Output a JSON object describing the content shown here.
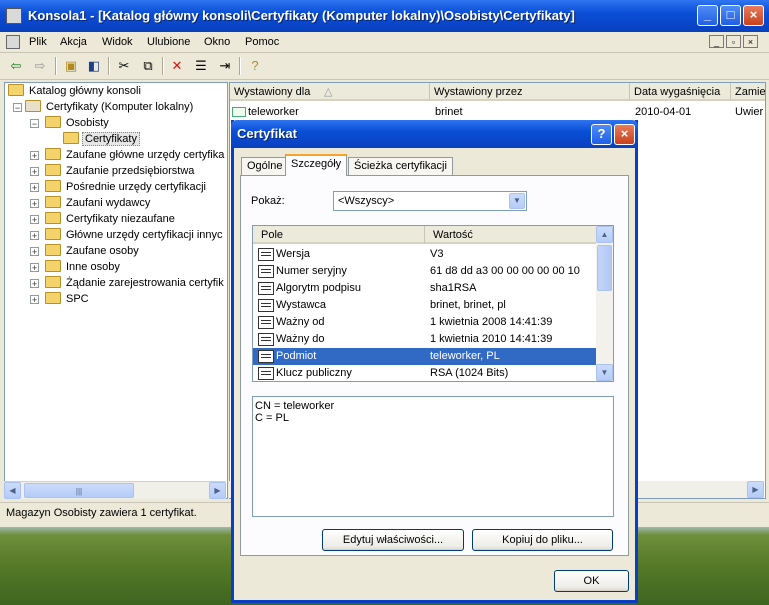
{
  "main_window": {
    "title": "Konsola1 - [Katalog główny konsoli\\Certyfikaty (Komputer lokalny)\\Osobisty\\Certyfikaty]",
    "menu": [
      "Plik",
      "Akcja",
      "Widok",
      "Ulubione",
      "Okno",
      "Pomoc"
    ],
    "toolbar_icons": [
      "back-icon",
      "forward-icon",
      "up-folder-icon",
      "show-tree-icon",
      "cut-icon",
      "copy-icon",
      "delete-icon",
      "properties-icon",
      "export-icon",
      "help-icon"
    ]
  },
  "tree": {
    "items": [
      {
        "label": "Katalog główny konsoli"
      },
      {
        "label": "Certyfikaty (Komputer lokalny)"
      },
      {
        "label": "Osobisty"
      },
      {
        "label": "Certyfikaty"
      },
      {
        "label": "Zaufane główne urzędy certyfika"
      },
      {
        "label": "Zaufanie przedsiębiorstwa"
      },
      {
        "label": "Pośrednie urzędy certyfikacji"
      },
      {
        "label": "Zaufani wydawcy"
      },
      {
        "label": "Certyfikaty niezaufane"
      },
      {
        "label": "Główne urzędy certyfikacji innyc"
      },
      {
        "label": "Zaufane osoby"
      },
      {
        "label": "Inne osoby"
      },
      {
        "label": "Żądanie zarejestrowania certyfik"
      },
      {
        "label": "SPC"
      }
    ]
  },
  "list": {
    "columns": [
      "Wystawiony dla",
      "Wystawiony przez",
      "Data wygaśnięcia",
      "Zamie"
    ],
    "rows": [
      {
        "issued_to": "teleworker",
        "issued_by": "brinet",
        "expires": "2010-04-01",
        "purpose": "Uwier"
      }
    ]
  },
  "status_bar": {
    "text": "Magazyn Osobisty zawiera 1 certyfikat."
  },
  "dialog": {
    "title": "Certyfikat",
    "tabs": [
      "Ogólne",
      "Szczegóły",
      "Ścieżka certyfikacji"
    ],
    "active_tab": "Szczegóły",
    "show_label": "Pokaż:",
    "show_value": "<Wszyscy>",
    "field_columns": [
      "Pole",
      "Wartość"
    ],
    "fields": [
      {
        "name": "Wersja",
        "value": "V3"
      },
      {
        "name": "Numer seryjny",
        "value": "61 d8 dd a3 00 00 00 00 00 10"
      },
      {
        "name": "Algorytm podpisu",
        "value": "sha1RSA"
      },
      {
        "name": "Wystawca",
        "value": "brinet, brinet, pl"
      },
      {
        "name": "Ważny od",
        "value": "1 kwietnia 2008 14:41:39"
      },
      {
        "name": "Ważny do",
        "value": "1 kwietnia 2010 14:41:39"
      },
      {
        "name": "Podmiot",
        "value": "teleworker, PL",
        "selected": true
      },
      {
        "name": "Klucz publiczny",
        "value": "RSA (1024 Bits)"
      }
    ],
    "detail_lines": [
      "CN = teleworker",
      "C = PL"
    ],
    "edit_button": "Edytuj właściwości...",
    "copy_button": "Kopiuj do pliku...",
    "ok_button": "OK"
  },
  "colors": {
    "titlebar": "#0a4fd6",
    "selection": "#316ac5",
    "window_bg": "#ece9d8"
  }
}
